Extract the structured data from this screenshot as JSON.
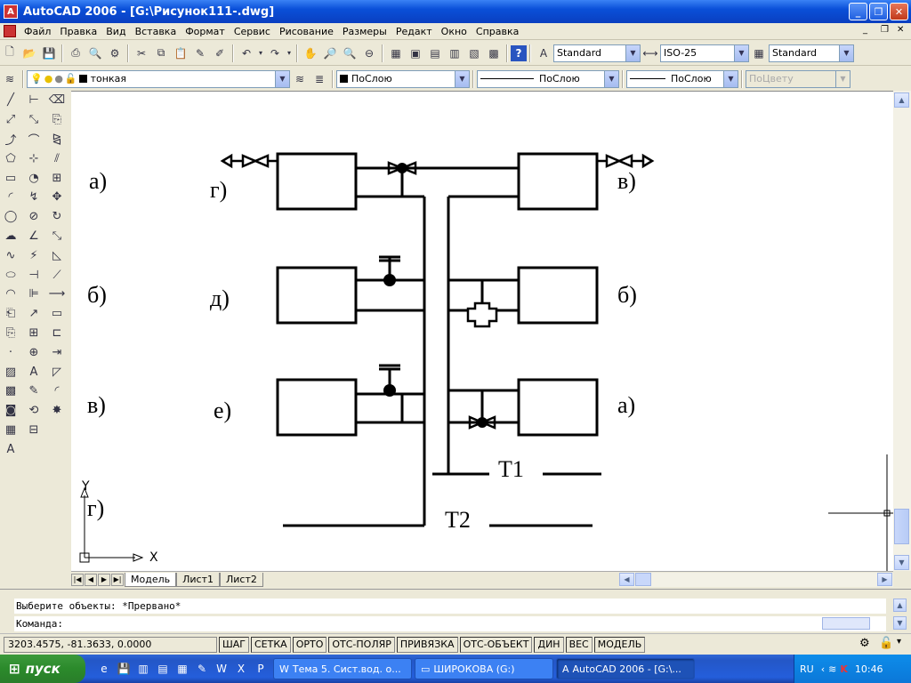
{
  "window": {
    "title": "AutoCAD 2006 - [G:\\Рисунок111-.dwg]"
  },
  "menu": {
    "items": [
      "Файл",
      "Правка",
      "Вид",
      "Вставка",
      "Формат",
      "Сервис",
      "Рисование",
      "Размеры",
      "Редакт",
      "Окно",
      "Справка"
    ]
  },
  "toolbar": {
    "text_style": "Standard",
    "dim_style": "ISO-25",
    "table_style": "Standard"
  },
  "layers": {
    "current_layer": "тонкая",
    "color": "ПоСлою",
    "linetype": "ПоСлою",
    "lineweight": "ПоСлою",
    "plotstyle": "ПоЦвету"
  },
  "drawing": {
    "left_labels": [
      "а)",
      "б)",
      "в)",
      "г)"
    ],
    "mid_labels": [
      "г)",
      "д)",
      "е)"
    ],
    "right_labels": [
      "в)",
      "б)",
      "а)"
    ],
    "t1": "Т1",
    "t2": "Т2",
    "ucs_x": "X",
    "ucs_y": "Y"
  },
  "layout_tabs": [
    "Модель",
    "Лист1",
    "Лист2"
  ],
  "command": {
    "history": "Выберите объекты: *Прервано*",
    "prompt": "Команда:"
  },
  "status": {
    "coords": "3203.4575, -81.3633, 0.0000",
    "toggles": [
      "ШАГ",
      "СЕТКА",
      "ОРТО",
      "ОТС-ПОЛЯР",
      "ПРИВЯЗКА",
      "ОТС-ОБЪЕКТ",
      "ДИН",
      "ВЕС",
      "МОДЕЛЬ"
    ]
  },
  "taskbar": {
    "start": "пуск",
    "tasks": [
      "Тема 5. Сист.вод. о...",
      "ШИРОКОВА (G:)",
      "AutoCAD 2006 - [G:\\..."
    ],
    "lang": "RU",
    "clock": "10:46"
  },
  "colors": {
    "titlebar": "#0a4fd8",
    "taskbar": "#245edb",
    "start": "#2b8a2b"
  }
}
